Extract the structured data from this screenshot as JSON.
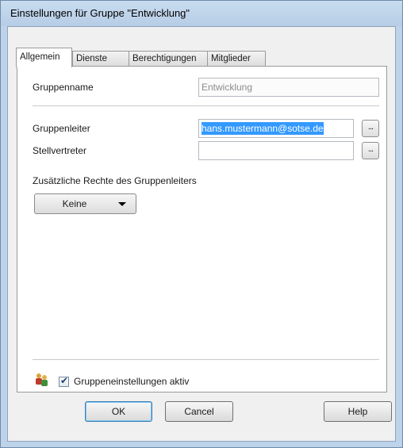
{
  "window": {
    "title": "Einstellungen für Gruppe \"Entwicklung\""
  },
  "tabs": [
    {
      "label": "Allgemein",
      "active": true
    },
    {
      "label": "Dienste",
      "active": false
    },
    {
      "label": "Berechtigungen",
      "active": false
    },
    {
      "label": "Mitglieder",
      "active": false
    }
  ],
  "form": {
    "group_name_label": "Gruppenname",
    "group_name_value": "Entwicklung",
    "leader_label": "Gruppenleiter",
    "leader_value": "hans.mustermann@sotse.de",
    "deputy_label": "Stellvertreter",
    "deputy_value": "",
    "browse_label": "...",
    "extra_rights_label": "Zusätzliche Rechte des Gruppenleiters",
    "extra_rights_value": "Keine",
    "active_checkbox_label": "Gruppeneinstellungen aktiv",
    "active_checked": true
  },
  "buttons": {
    "ok": "OK",
    "cancel": "Cancel",
    "help": "Help"
  },
  "icons": {
    "group": "group-users-icon",
    "dropdown_arrow": "chevron-down-icon",
    "check": "checkmark-icon"
  },
  "colors": {
    "selection": "#3399ff",
    "titlebar": "#bcd3ea",
    "dialog_bg": "#f0f0f0"
  }
}
